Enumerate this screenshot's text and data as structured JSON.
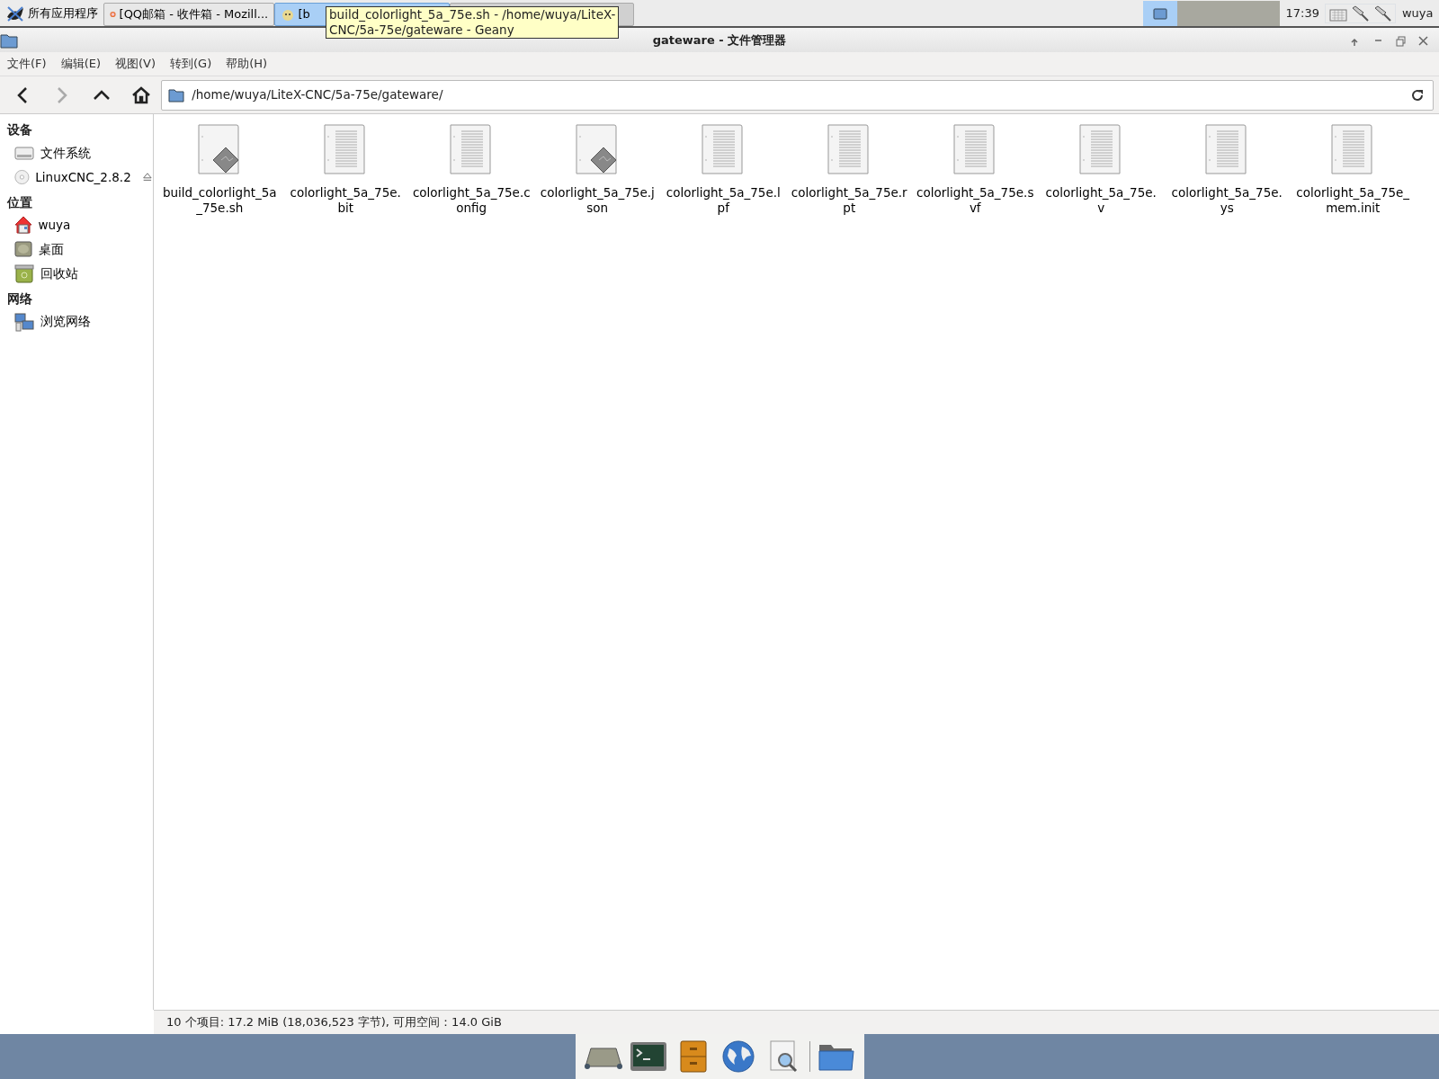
{
  "taskbar": {
    "start_label": "所有应用程序",
    "tasks": [
      {
        "label": "[QQ邮箱 - 收件箱 - Mozill...",
        "kind": "browser",
        "selected": false
      },
      {
        "label": "[b",
        "kind": "editor",
        "selected": true
      },
      {
        "kind": "other",
        "selected": false
      }
    ],
    "tooltip": [
      "build_colorlight_5a_75e.sh - /home/wuya/LiteX-",
      "CNC/5a-75e/gateware - Geany"
    ],
    "desktops": [
      {
        "selected": true
      },
      {
        "selected": false
      },
      {
        "selected": false
      },
      {
        "selected": false
      }
    ],
    "clock": "17:39",
    "user": "wuya"
  },
  "window": {
    "title": "gateware - 文件管理器"
  },
  "menu": [
    "文件(F)",
    "编辑(E)",
    "视图(V)",
    "转到(G)",
    "帮助(H)"
  ],
  "toolbar": {
    "back_disabled": false,
    "forward_disabled": true,
    "path": "/home/wuya/LiteX-CNC/5a-75e/gateware/"
  },
  "sidebar": [
    {
      "heading": "设备",
      "items": [
        {
          "label": "文件系统",
          "kind": "drive"
        },
        {
          "label": "LinuxCNC_2.8.2",
          "kind": "disc",
          "eject": true
        }
      ]
    },
    {
      "heading": "位置",
      "items": [
        {
          "label": "wuya",
          "kind": "home"
        },
        {
          "label": "桌面",
          "kind": "desktop"
        },
        {
          "label": "回收站",
          "kind": "trash"
        }
      ]
    },
    {
      "heading": "网络",
      "items": [
        {
          "label": "浏览网络",
          "kind": "network"
        }
      ]
    }
  ],
  "files": [
    {
      "name": "build_colorlight_5a_75e.sh",
      "kind": "script"
    },
    {
      "name": "colorlight_5a_75e.bit",
      "kind": "text"
    },
    {
      "name": "colorlight_5a_75e.config",
      "kind": "text"
    },
    {
      "name": "colorlight_5a_75e.json",
      "kind": "script"
    },
    {
      "name": "colorlight_5a_75e.lpf",
      "kind": "text"
    },
    {
      "name": "colorlight_5a_75e.rpt",
      "kind": "text"
    },
    {
      "name": "colorlight_5a_75e.svf",
      "kind": "text"
    },
    {
      "name": "colorlight_5a_75e.v",
      "kind": "text"
    },
    {
      "name": "colorlight_5a_75e.ys",
      "kind": "text"
    },
    {
      "name": "colorlight_5a_75e_mem.init",
      "kind": "text"
    }
  ],
  "status_bar": "10 个项目: 17.2 MiB (18,036,523 字节), 可用空间：14.0 GiB",
  "dock": [
    {
      "kind": "display"
    },
    {
      "kind": "terminal"
    },
    {
      "kind": "cabinet"
    },
    {
      "kind": "globe"
    },
    {
      "kind": "viewer"
    },
    {
      "kind": "separator"
    },
    {
      "kind": "folder"
    }
  ]
}
